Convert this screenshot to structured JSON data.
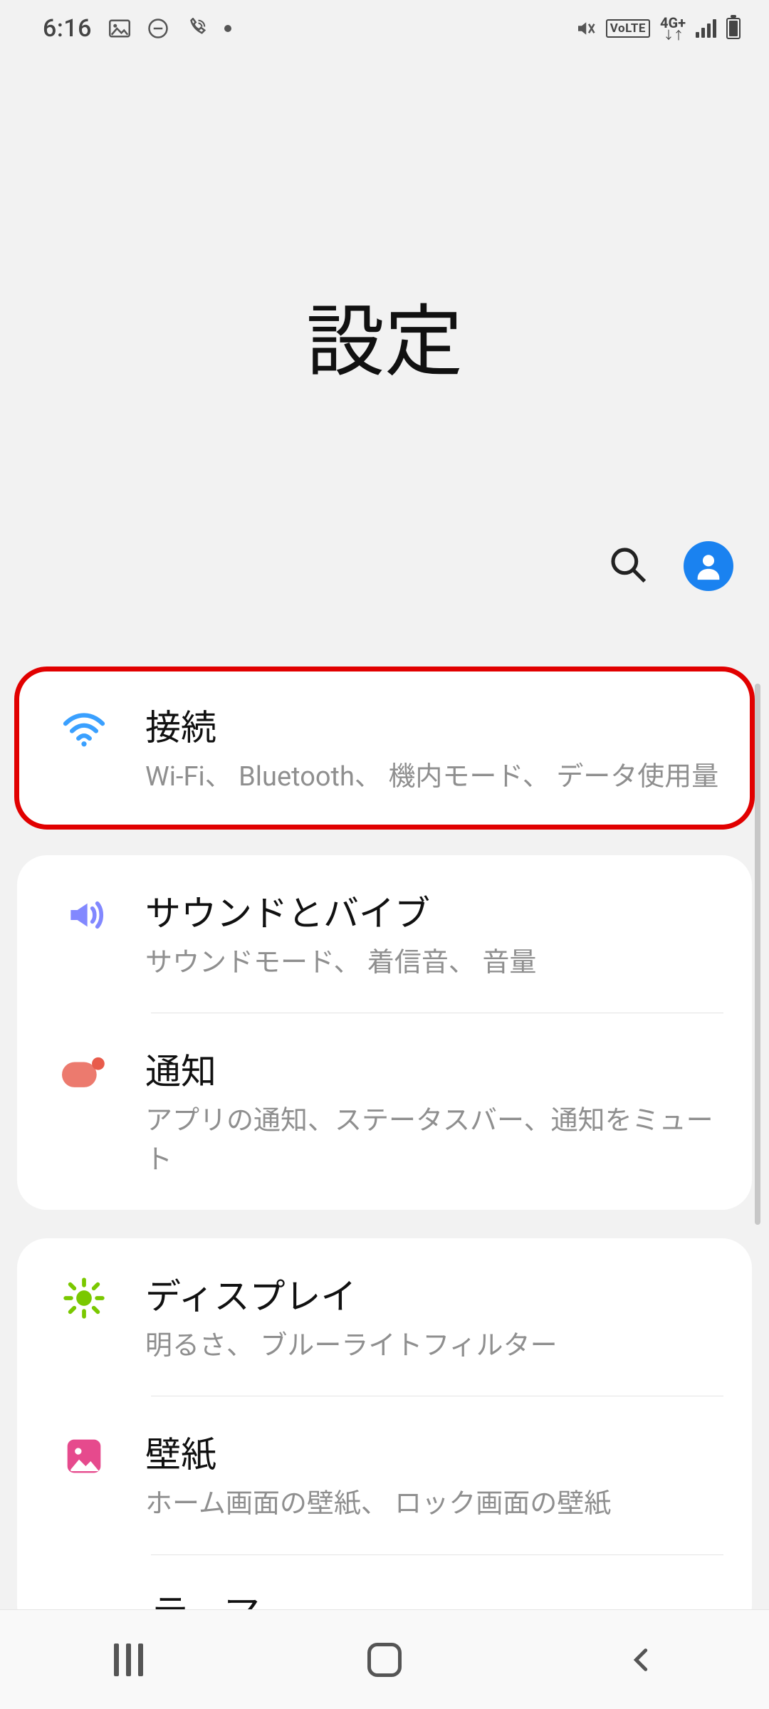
{
  "status_bar": {
    "time": "6:16",
    "network_label": "4G+",
    "volte": "VoLTE"
  },
  "page": {
    "title": "設定"
  },
  "items": {
    "connections": {
      "title": "接続",
      "subtitle": "Wi-Fi、 Bluetooth、 機内モード、 データ使用量"
    },
    "sound": {
      "title": "サウンドとバイブ",
      "subtitle": "サウンドモード、 着信音、 音量"
    },
    "notifications": {
      "title": "通知",
      "subtitle": "アプリの通知、ステータスバー、通知をミュート"
    },
    "display": {
      "title": "ディスプレイ",
      "subtitle": "明るさ、 ブルーライトフィルター"
    },
    "wallpaper": {
      "title": "壁紙",
      "subtitle": "ホーム画面の壁紙、 ロック画面の壁紙"
    },
    "cutoff": {
      "title_fragment": "テ マ"
    }
  }
}
